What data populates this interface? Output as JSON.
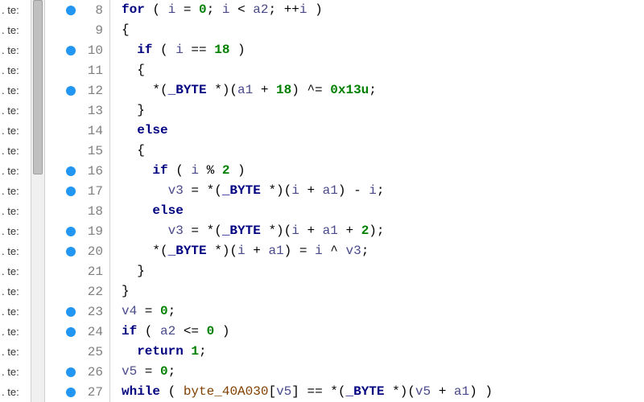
{
  "sidebar": {
    "items": [
      ". te:",
      ". te:",
      ". te:",
      ". te:",
      ". te:",
      ". te:",
      ". te:",
      ". te:",
      ". te:",
      ". te:",
      ". te:",
      ". te:",
      ". te:",
      ". te:",
      ". te:",
      ". te:",
      ". te:",
      ". te:",
      ". te:",
      ". te:"
    ]
  },
  "gutter": {
    "rows": [
      {
        "n": "8",
        "bp": true
      },
      {
        "n": "9",
        "bp": false
      },
      {
        "n": "10",
        "bp": true
      },
      {
        "n": "11",
        "bp": false
      },
      {
        "n": "12",
        "bp": true
      },
      {
        "n": "13",
        "bp": false
      },
      {
        "n": "14",
        "bp": false
      },
      {
        "n": "15",
        "bp": false
      },
      {
        "n": "16",
        "bp": true
      },
      {
        "n": "17",
        "bp": true
      },
      {
        "n": "18",
        "bp": false
      },
      {
        "n": "19",
        "bp": true
      },
      {
        "n": "20",
        "bp": true
      },
      {
        "n": "21",
        "bp": false
      },
      {
        "n": "22",
        "bp": false
      },
      {
        "n": "23",
        "bp": true
      },
      {
        "n": "24",
        "bp": true
      },
      {
        "n": "25",
        "bp": false
      },
      {
        "n": "26",
        "bp": true
      },
      {
        "n": "27",
        "bp": true
      }
    ]
  },
  "code": {
    "lines": [
      [
        {
          "c": "t-kw",
          "t": "for"
        },
        {
          "c": "t-pun",
          "t": " ( "
        },
        {
          "c": "t-id",
          "t": "i"
        },
        {
          "c": "t-pun",
          "t": " = "
        },
        {
          "c": "t-num",
          "t": "0"
        },
        {
          "c": "t-pun",
          "t": "; "
        },
        {
          "c": "t-id",
          "t": "i"
        },
        {
          "c": "t-pun",
          "t": " < "
        },
        {
          "c": "t-id",
          "t": "a2"
        },
        {
          "c": "t-pun",
          "t": "; ++"
        },
        {
          "c": "t-id",
          "t": "i"
        },
        {
          "c": "t-pun",
          "t": " )"
        }
      ],
      [
        {
          "c": "t-pun",
          "t": "{"
        }
      ],
      [
        {
          "c": "t-pun",
          "t": "  "
        },
        {
          "c": "t-kw",
          "t": "if"
        },
        {
          "c": "t-pun",
          "t": " ( "
        },
        {
          "c": "t-id",
          "t": "i"
        },
        {
          "c": "t-pun",
          "t": " == "
        },
        {
          "c": "t-num",
          "t": "18"
        },
        {
          "c": "t-pun",
          "t": " )"
        }
      ],
      [
        {
          "c": "t-pun",
          "t": "  {"
        }
      ],
      [
        {
          "c": "t-pun",
          "t": "    *("
        },
        {
          "c": "t-type",
          "t": "_BYTE"
        },
        {
          "c": "t-pun",
          "t": " *)("
        },
        {
          "c": "t-id",
          "t": "a1"
        },
        {
          "c": "t-pun",
          "t": " + "
        },
        {
          "c": "t-num",
          "t": "18"
        },
        {
          "c": "t-pun",
          "t": ") ^= "
        },
        {
          "c": "t-num",
          "t": "0x13u"
        },
        {
          "c": "t-pun",
          "t": ";"
        }
      ],
      [
        {
          "c": "t-pun",
          "t": "  }"
        }
      ],
      [
        {
          "c": "t-pun",
          "t": "  "
        },
        {
          "c": "t-kw",
          "t": "else"
        }
      ],
      [
        {
          "c": "t-pun",
          "t": "  {"
        }
      ],
      [
        {
          "c": "t-pun",
          "t": "    "
        },
        {
          "c": "t-kw",
          "t": "if"
        },
        {
          "c": "t-pun",
          "t": " ( "
        },
        {
          "c": "t-id",
          "t": "i"
        },
        {
          "c": "t-pun",
          "t": " % "
        },
        {
          "c": "t-num",
          "t": "2"
        },
        {
          "c": "t-pun",
          "t": " )"
        }
      ],
      [
        {
          "c": "t-pun",
          "t": "      "
        },
        {
          "c": "t-id",
          "t": "v3"
        },
        {
          "c": "t-pun",
          "t": " = *("
        },
        {
          "c": "t-type",
          "t": "_BYTE"
        },
        {
          "c": "t-pun",
          "t": " *)("
        },
        {
          "c": "t-id",
          "t": "i"
        },
        {
          "c": "t-pun",
          "t": " + "
        },
        {
          "c": "t-id",
          "t": "a1"
        },
        {
          "c": "t-pun",
          "t": ") - "
        },
        {
          "c": "t-id",
          "t": "i"
        },
        {
          "c": "t-pun",
          "t": ";"
        }
      ],
      [
        {
          "c": "t-pun",
          "t": "    "
        },
        {
          "c": "t-kw",
          "t": "else"
        }
      ],
      [
        {
          "c": "t-pun",
          "t": "      "
        },
        {
          "c": "t-id",
          "t": "v3"
        },
        {
          "c": "t-pun",
          "t": " = *("
        },
        {
          "c": "t-type",
          "t": "_BYTE"
        },
        {
          "c": "t-pun",
          "t": " *)("
        },
        {
          "c": "t-id",
          "t": "i"
        },
        {
          "c": "t-pun",
          "t": " + "
        },
        {
          "c": "t-id",
          "t": "a1"
        },
        {
          "c": "t-pun",
          "t": " + "
        },
        {
          "c": "t-num",
          "t": "2"
        },
        {
          "c": "t-pun",
          "t": ");"
        }
      ],
      [
        {
          "c": "t-pun",
          "t": "    *("
        },
        {
          "c": "t-type",
          "t": "_BYTE"
        },
        {
          "c": "t-pun",
          "t": " *)("
        },
        {
          "c": "t-id",
          "t": "i"
        },
        {
          "c": "t-pun",
          "t": " + "
        },
        {
          "c": "t-id",
          "t": "a1"
        },
        {
          "c": "t-pun",
          "t": ") = "
        },
        {
          "c": "t-id",
          "t": "i"
        },
        {
          "c": "t-pun",
          "t": " ^ "
        },
        {
          "c": "t-id",
          "t": "v3"
        },
        {
          "c": "t-pun",
          "t": ";"
        }
      ],
      [
        {
          "c": "t-pun",
          "t": "  }"
        }
      ],
      [
        {
          "c": "t-pun",
          "t": "}"
        }
      ],
      [
        {
          "c": "t-id",
          "t": "v4"
        },
        {
          "c": "t-pun",
          "t": " = "
        },
        {
          "c": "t-num",
          "t": "0"
        },
        {
          "c": "t-pun",
          "t": ";"
        }
      ],
      [
        {
          "c": "t-kw",
          "t": "if"
        },
        {
          "c": "t-pun",
          "t": " ( "
        },
        {
          "c": "t-id",
          "t": "a2"
        },
        {
          "c": "t-pun",
          "t": " <= "
        },
        {
          "c": "t-num",
          "t": "0"
        },
        {
          "c": "t-pun",
          "t": " )"
        }
      ],
      [
        {
          "c": "t-pun",
          "t": "  "
        },
        {
          "c": "t-kw",
          "t": "return"
        },
        {
          "c": "t-pun",
          "t": " "
        },
        {
          "c": "t-num",
          "t": "1"
        },
        {
          "c": "t-pun",
          "t": ";"
        }
      ],
      [
        {
          "c": "t-id",
          "t": "v5"
        },
        {
          "c": "t-pun",
          "t": " = "
        },
        {
          "c": "t-num",
          "t": "0"
        },
        {
          "c": "t-pun",
          "t": ";"
        }
      ],
      [
        {
          "c": "t-kw",
          "t": "while"
        },
        {
          "c": "t-pun",
          "t": " ( "
        },
        {
          "c": "t-glob",
          "t": "byte_40A030"
        },
        {
          "c": "t-pun",
          "t": "["
        },
        {
          "c": "t-id",
          "t": "v5"
        },
        {
          "c": "t-pun",
          "t": "] == *("
        },
        {
          "c": "t-type",
          "t": "_BYTE"
        },
        {
          "c": "t-pun",
          "t": " *)("
        },
        {
          "c": "t-id",
          "t": "v5"
        },
        {
          "c": "t-pun",
          "t": " + "
        },
        {
          "c": "t-id",
          "t": "a1"
        },
        {
          "c": "t-pun",
          "t": ") )"
        }
      ]
    ]
  }
}
